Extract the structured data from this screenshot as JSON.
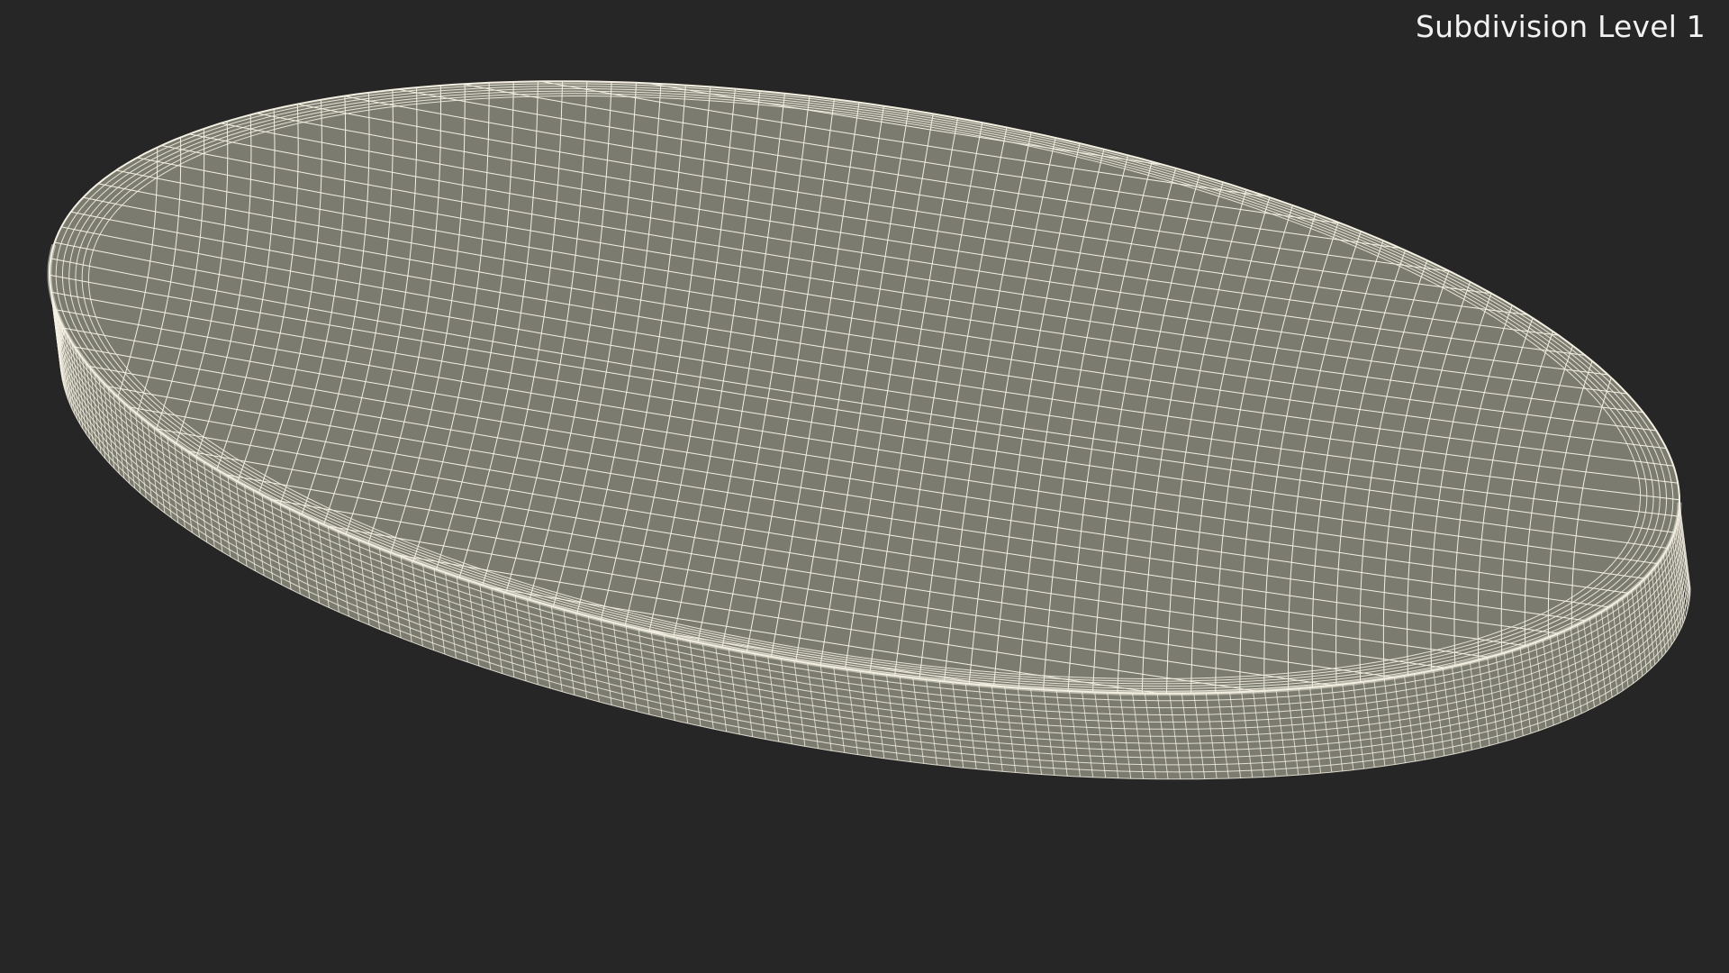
{
  "viewport": {
    "caption": "Subdivision Level 1"
  },
  "colors": {
    "background": "#262626",
    "surface": "#7b7b6f",
    "wire": "#f3f0e2",
    "caption": "#f2f2f2"
  }
}
